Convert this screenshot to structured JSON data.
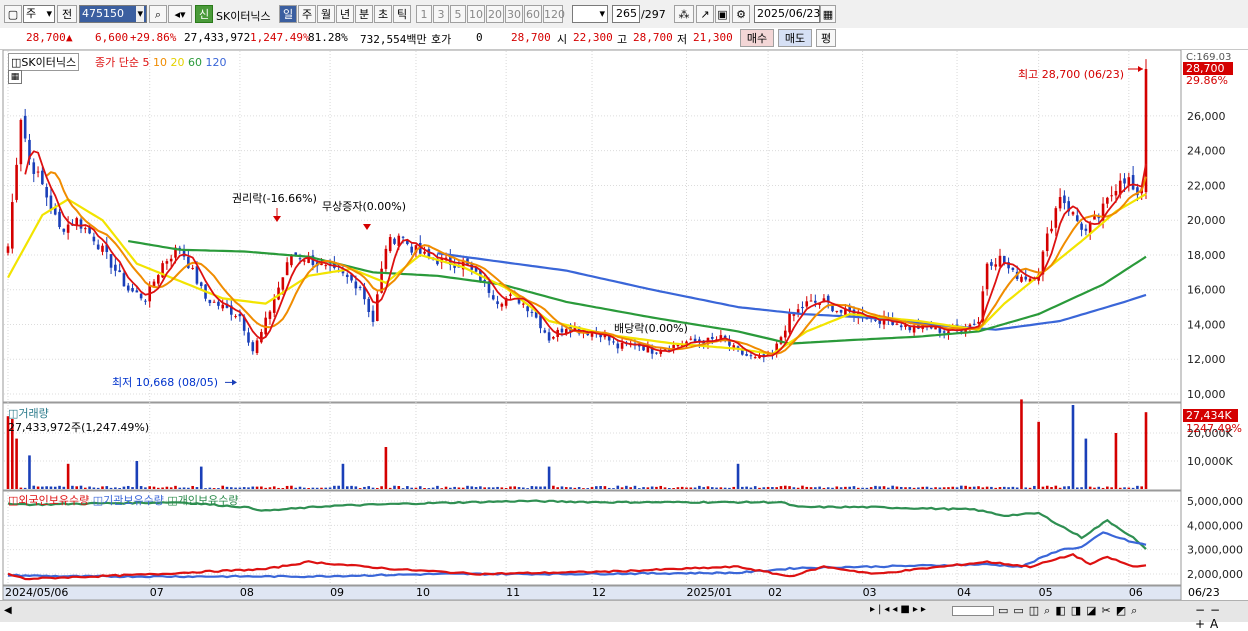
{
  "toolbar": {
    "type_value": "주",
    "prev_label": "전",
    "code_value": "475150",
    "new_badge": "신",
    "stock_name": "SK이터닉스",
    "periods": [
      "일",
      "주",
      "월",
      "년",
      "분",
      "초",
      "틱"
    ],
    "intervals": [
      "1",
      "3",
      "5",
      "10",
      "20",
      "30",
      "60",
      "120"
    ],
    "count_value": "265",
    "count_total": "/297",
    "date_value": "2025/06/23"
  },
  "infobar": {
    "price": "28,700",
    "change": "6,600",
    "change_pct": "+29.86%",
    "volume": "27,433,972",
    "volume_pct": "1,247.49%",
    "turnover_pct": "81.28%",
    "amount": "732,554백만",
    "quote_label": "호가",
    "quote_value": "0",
    "quote_price": "28,700",
    "open_label": "시",
    "open": "22,300",
    "high_label": "고",
    "high": "28,700",
    "low_label": "저",
    "low": "21,300",
    "buy_label": "매수",
    "sell_label": "매도",
    "eval_label": "평"
  },
  "colors": {
    "up": "#d40000",
    "down": "#1a3fb8",
    "ma5": "#dd1111",
    "ma10": "#f08c00",
    "ma20": "#f2e400",
    "ma60": "#2a9a3a",
    "ma120": "#3a66d8",
    "foreign": "#2f8f52",
    "institution": "#3a66d8",
    "individual": "#dd1111"
  },
  "chart_data": [
    {
      "type": "candlestick",
      "title": "SK이터닉스",
      "legend": [
        "종가 단순 5",
        "10",
        "20",
        "60",
        "120"
      ],
      "x_ticks": [
        "2024/05/06",
        "07",
        "08",
        "09",
        "10",
        "11",
        "12",
        "2025/01",
        "02",
        "03",
        "04",
        "05",
        "06",
        "06/23"
      ],
      "y_ticks": [
        10000,
        12000,
        14000,
        16000,
        18000,
        20000,
        22000,
        24000,
        26000
      ],
      "ylim": [
        9500,
        29200
      ],
      "top_right_label": "C:169.03",
      "last_price_label": "28,700",
      "last_pct_label": "29.86%",
      "annotations": {
        "high": "최고 28,700 (06/23)",
        "low": "최저 10,668 (08/05)",
        "rights": "권리락(-16.66%)",
        "bonus": "무상증자(0.00%)",
        "dividend": "배당락(0.00%)"
      },
      "close_anchors": [
        [
          0,
          18500
        ],
        [
          3,
          26000
        ],
        [
          5,
          23500
        ],
        [
          8,
          22000
        ],
        [
          12,
          19500
        ],
        [
          16,
          20000
        ],
        [
          20,
          19000
        ],
        [
          24,
          17500
        ],
        [
          28,
          16000
        ],
        [
          32,
          15500
        ],
        [
          36,
          17500
        ],
        [
          40,
          18500
        ],
        [
          43,
          17000
        ],
        [
          46,
          15500
        ],
        [
          50,
          15000
        ],
        [
          54,
          14500
        ],
        [
          57,
          12500
        ],
        [
          59,
          13500
        ],
        [
          62,
          15500
        ],
        [
          66,
          18000
        ],
        [
          70,
          17800
        ],
        [
          74,
          17200
        ],
        [
          78,
          16800
        ],
        [
          82,
          16200
        ],
        [
          85,
          14200
        ],
        [
          88,
          18500
        ],
        [
          91,
          19200
        ],
        [
          94,
          18400
        ],
        [
          98,
          17800
        ],
        [
          102,
          17600
        ],
        [
          106,
          17500
        ],
        [
          110,
          16600
        ],
        [
          114,
          15400
        ],
        [
          118,
          15600
        ],
        [
          122,
          14800
        ],
        [
          126,
          13200
        ],
        [
          130,
          13900
        ],
        [
          134,
          13600
        ],
        [
          138,
          13500
        ],
        [
          142,
          12700
        ],
        [
          146,
          12900
        ],
        [
          150,
          12500
        ],
        [
          154,
          12700
        ],
        [
          158,
          13000
        ],
        [
          162,
          13000
        ],
        [
          166,
          13200
        ],
        [
          170,
          12400
        ],
        [
          174,
          12000
        ],
        [
          178,
          12200
        ],
        [
          182,
          14400
        ],
        [
          186,
          15200
        ],
        [
          190,
          15300
        ],
        [
          194,
          14700
        ],
        [
          198,
          14600
        ],
        [
          202,
          14300
        ],
        [
          206,
          14200
        ],
        [
          210,
          13800
        ],
        [
          214,
          13900
        ],
        [
          218,
          13600
        ],
        [
          222,
          13800
        ],
        [
          226,
          14200
        ],
        [
          228,
          17600
        ],
        [
          231,
          17800
        ],
        [
          234,
          16900
        ],
        [
          238,
          16700
        ],
        [
          240,
          17100
        ],
        [
          242,
          19000
        ],
        [
          245,
          21500
        ],
        [
          248,
          20300
        ],
        [
          251,
          19300
        ],
        [
          254,
          20200
        ],
        [
          257,
          21500
        ],
        [
          259,
          22500
        ],
        [
          261,
          22300
        ],
        [
          263,
          21100
        ],
        [
          264,
          22000
        ],
        [
          265,
          28700
        ]
      ],
      "ma_anchors": {
        "ma20": [
          [
            0,
            16700
          ],
          [
            8,
            20300
          ],
          [
            14,
            21200
          ],
          [
            22,
            20000
          ],
          [
            30,
            17500
          ],
          [
            40,
            16500
          ],
          [
            50,
            15500
          ],
          [
            60,
            15200
          ],
          [
            70,
            16800
          ],
          [
            80,
            17200
          ],
          [
            88,
            16400
          ],
          [
            96,
            18000
          ],
          [
            106,
            17300
          ],
          [
            116,
            16100
          ],
          [
            126,
            14200
          ],
          [
            140,
            13400
          ],
          [
            155,
            12900
          ],
          [
            170,
            12600
          ],
          [
            178,
            12300
          ],
          [
            186,
            13600
          ],
          [
            196,
            14600
          ],
          [
            212,
            14200
          ],
          [
            226,
            13700
          ],
          [
            232,
            15200
          ],
          [
            240,
            16800
          ],
          [
            250,
            18800
          ],
          [
            258,
            20500
          ],
          [
            265,
            21500
          ]
        ],
        "ma60": [
          [
            28,
            18800
          ],
          [
            40,
            18300
          ],
          [
            55,
            18200
          ],
          [
            70,
            17900
          ],
          [
            85,
            17000
          ],
          [
            100,
            16800
          ],
          [
            115,
            16300
          ],
          [
            130,
            15300
          ],
          [
            150,
            14400
          ],
          [
            170,
            13600
          ],
          [
            182,
            12900
          ],
          [
            196,
            13100
          ],
          [
            212,
            13300
          ],
          [
            226,
            13600
          ],
          [
            240,
            14600
          ],
          [
            255,
            16300
          ],
          [
            265,
            17900
          ]
        ],
        "ma120": [
          [
            100,
            18100
          ],
          [
            115,
            17600
          ],
          [
            130,
            17100
          ],
          [
            150,
            16000
          ],
          [
            170,
            15000
          ],
          [
            185,
            14600
          ],
          [
            200,
            14400
          ],
          [
            215,
            14000
          ],
          [
            230,
            13700
          ],
          [
            245,
            14200
          ],
          [
            260,
            15300
          ],
          [
            265,
            15700
          ]
        ]
      },
      "volume": {
        "label": "거래량",
        "value_label": "27,433,972주(1,247.49%)",
        "y_ticks": [
          "10,000K",
          "20,000K"
        ],
        "last_label": "27,434K",
        "last_pct": "1247.49%",
        "last_value_k": 27434
      },
      "holdings": {
        "legend": [
          "외국인보유수량",
          "기관보유수량",
          "개인보유수량"
        ],
        "y_ticks": [
          "2,000,000",
          "3,000,000",
          "4,000,000",
          "5,000,000"
        ],
        "foreign_anchors": [
          [
            0,
            4900
          ],
          [
            6,
            4850
          ],
          [
            20,
            4900
          ],
          [
            40,
            4950
          ],
          [
            55,
            4750
          ],
          [
            60,
            4600
          ],
          [
            75,
            4800
          ],
          [
            95,
            4900
          ],
          [
            120,
            5000
          ],
          [
            140,
            4950
          ],
          [
            165,
            4950
          ],
          [
            180,
            4950
          ],
          [
            184,
            4750
          ],
          [
            200,
            4750
          ],
          [
            225,
            4650
          ],
          [
            232,
            4400
          ],
          [
            240,
            4500
          ],
          [
            250,
            3500
          ],
          [
            256,
            4200
          ],
          [
            262,
            3500
          ],
          [
            265,
            3000
          ]
        ],
        "institution_anchors": [
          [
            0,
            1950
          ],
          [
            15,
            1900
          ],
          [
            40,
            1900
          ],
          [
            70,
            1900
          ],
          [
            100,
            2000
          ],
          [
            130,
            2000
          ],
          [
            170,
            2050
          ],
          [
            184,
            2250
          ],
          [
            200,
            2300
          ],
          [
            215,
            2350
          ],
          [
            228,
            2400
          ],
          [
            236,
            2300
          ],
          [
            245,
            3000
          ],
          [
            250,
            3100
          ],
          [
            255,
            3700
          ],
          [
            262,
            3300
          ],
          [
            265,
            3200
          ]
        ],
        "individual_anchors": [
          [
            0,
            2000
          ],
          [
            4,
            1800
          ],
          [
            20,
            1900
          ],
          [
            35,
            2000
          ],
          [
            46,
            2100
          ],
          [
            60,
            2200
          ],
          [
            70,
            2500
          ],
          [
            90,
            2200
          ],
          [
            110,
            2000
          ],
          [
            140,
            2100
          ],
          [
            170,
            2300
          ],
          [
            182,
            1900
          ],
          [
            190,
            2300
          ],
          [
            202,
            2000
          ],
          [
            212,
            2200
          ],
          [
            228,
            2500
          ],
          [
            238,
            2300
          ],
          [
            248,
            2800
          ],
          [
            252,
            2400
          ],
          [
            256,
            2700
          ],
          [
            262,
            2300
          ],
          [
            265,
            2350
          ]
        ]
      }
    }
  ]
}
